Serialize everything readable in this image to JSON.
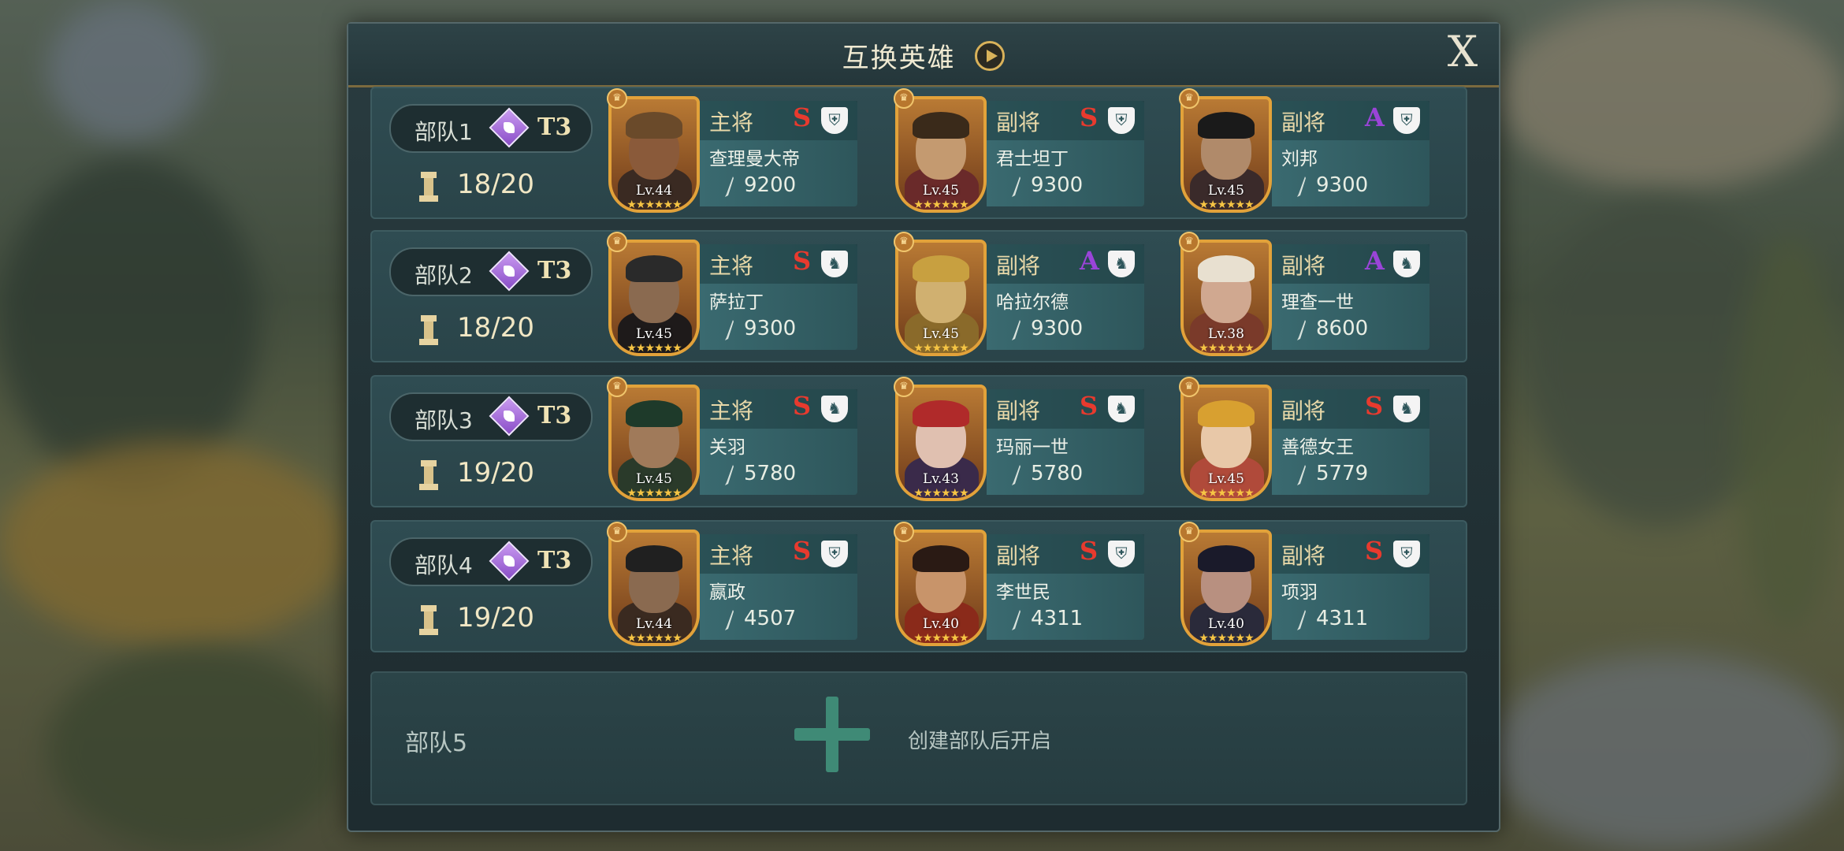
{
  "dialog": {
    "title": "互换英雄",
    "close_label": "X"
  },
  "troops": [
    {
      "name": "部队1",
      "tier": "T3",
      "capacity": "18/20",
      "heroes": [
        {
          "role": "主将",
          "grade": "S",
          "unit": "shield",
          "name": "查理曼大帝",
          "level": "Lv.44",
          "power": "9200"
        },
        {
          "role": "副将",
          "grade": "S",
          "unit": "shield",
          "name": "君士坦丁",
          "level": "Lv.45",
          "power": "9300"
        },
        {
          "role": "副将",
          "grade": "A",
          "unit": "shield",
          "name": "刘邦",
          "level": "Lv.45",
          "power": "9300"
        }
      ]
    },
    {
      "name": "部队2",
      "tier": "T3",
      "capacity": "18/20",
      "heroes": [
        {
          "role": "主将",
          "grade": "S",
          "unit": "horse",
          "name": "萨拉丁",
          "level": "Lv.45",
          "power": "9300"
        },
        {
          "role": "副将",
          "grade": "A",
          "unit": "horse",
          "name": "哈拉尔德",
          "level": "Lv.45",
          "power": "9300"
        },
        {
          "role": "副将",
          "grade": "A",
          "unit": "horse",
          "name": "理查一世",
          "level": "Lv.38",
          "power": "8600"
        }
      ]
    },
    {
      "name": "部队3",
      "tier": "T3",
      "capacity": "19/20",
      "heroes": [
        {
          "role": "主将",
          "grade": "S",
          "unit": "horse",
          "name": "关羽",
          "level": "Lv.45",
          "power": "5780"
        },
        {
          "role": "副将",
          "grade": "S",
          "unit": "horse",
          "name": "玛丽一世",
          "level": "Lv.43",
          "power": "5780"
        },
        {
          "role": "副将",
          "grade": "S",
          "unit": "horse",
          "name": "善德女王",
          "level": "Lv.45",
          "power": "5779"
        }
      ]
    },
    {
      "name": "部队4",
      "tier": "T3",
      "capacity": "19/20",
      "heroes": [
        {
          "role": "主将",
          "grade": "S",
          "unit": "shield",
          "name": "嬴政",
          "level": "Lv.44",
          "power": "4507"
        },
        {
          "role": "副将",
          "grade": "S",
          "unit": "shield",
          "name": "李世民",
          "level": "Lv.40",
          "power": "4311"
        },
        {
          "role": "副将",
          "grade": "S",
          "unit": "shield",
          "name": "项羽",
          "level": "Lv.40",
          "power": "4311"
        }
      ]
    }
  ],
  "troop5": {
    "name": "部队5",
    "hint": "创建部队后开启"
  },
  "colors": {
    "grade_S": "#e83a2e",
    "grade_A": "#9a44d8",
    "portrait_border": "#e2a23a",
    "panel": "#24363a"
  }
}
